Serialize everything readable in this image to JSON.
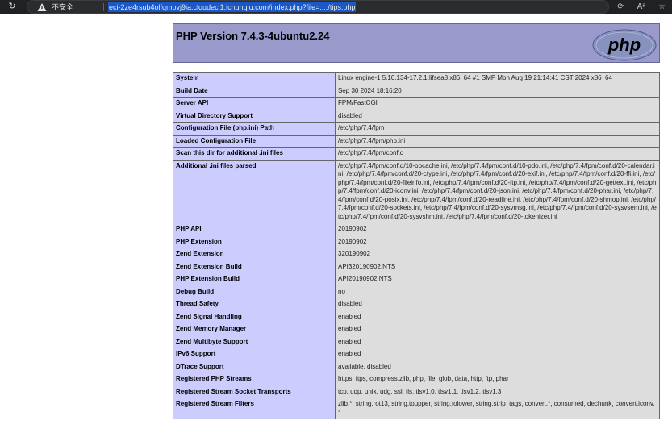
{
  "browser": {
    "reload_icon": "reload-icon",
    "security_label": "不安全",
    "url": "eci-2ze4rsub4olfqmovj9ia.cloudeci1.ichunqiu.com/index.php?file=..../tips.php",
    "right_icons": [
      "extension-icon",
      "read-aloud-icon",
      "favorite-icon"
    ]
  },
  "phpinfo": {
    "title": "PHP Version 7.4.3-4ubuntu2.24",
    "logo_text": "php",
    "colors": {
      "header_bg": "#9999cc",
      "key_bg": "#ccccff",
      "value_bg": "#dddddd",
      "logo_bg": "#8892bf"
    },
    "rows": [
      {
        "key": "System",
        "value": "Linux engine-1 5.10.134-17.2.1.lifsea8.x86_64 #1 SMP Mon Aug 19 21:14:41 CST 2024 x86_64"
      },
      {
        "key": "Build Date",
        "value": "Sep 30 2024 18:16:20"
      },
      {
        "key": "Server API",
        "value": "FPM/FastCGI"
      },
      {
        "key": "Virtual Directory Support",
        "value": "disabled"
      },
      {
        "key": "Configuration File (php.ini) Path",
        "value": "/etc/php/7.4/fpm"
      },
      {
        "key": "Loaded Configuration File",
        "value": "/etc/php/7.4/fpm/php.ini"
      },
      {
        "key": "Scan this dir for additional .ini files",
        "value": "/etc/php/7.4/fpm/conf.d"
      },
      {
        "key": "Additional .ini files parsed",
        "value": "/etc/php/7.4/fpm/conf.d/10-opcache.ini, /etc/php/7.4/fpm/conf.d/10-pdo.ini, /etc/php/7.4/fpm/conf.d/20-calendar.ini, /etc/php/7.4/fpm/conf.d/20-ctype.ini, /etc/php/7.4/fpm/conf.d/20-exif.ini, /etc/php/7.4/fpm/conf.d/20-ffi.ini, /etc/php/7.4/fpm/conf.d/20-fileinfo.ini, /etc/php/7.4/fpm/conf.d/20-ftp.ini, /etc/php/7.4/fpm/conf.d/20-gettext.ini, /etc/php/7.4/fpm/conf.d/20-iconv.ini, /etc/php/7.4/fpm/conf.d/20-json.ini, /etc/php/7.4/fpm/conf.d/20-phar.ini, /etc/php/7.4/fpm/conf.d/20-posix.ini, /etc/php/7.4/fpm/conf.d/20-readline.ini, /etc/php/7.4/fpm/conf.d/20-shmop.ini, /etc/php/7.4/fpm/conf.d/20-sockets.ini, /etc/php/7.4/fpm/conf.d/20-sysvmsg.ini, /etc/php/7.4/fpm/conf.d/20-sysvsem.ini, /etc/php/7.4/fpm/conf.d/20-sysvshm.ini, /etc/php/7.4/fpm/conf.d/20-tokenizer.ini"
      },
      {
        "key": "PHP API",
        "value": "20190902"
      },
      {
        "key": "PHP Extension",
        "value": "20190902"
      },
      {
        "key": "Zend Extension",
        "value": "320190902"
      },
      {
        "key": "Zend Extension Build",
        "value": "API320190902,NTS"
      },
      {
        "key": "PHP Extension Build",
        "value": "API20190902,NTS"
      },
      {
        "key": "Debug Build",
        "value": "no"
      },
      {
        "key": "Thread Safety",
        "value": "disabled"
      },
      {
        "key": "Zend Signal Handling",
        "value": "enabled"
      },
      {
        "key": "Zend Memory Manager",
        "value": "enabled"
      },
      {
        "key": "Zend Multibyte Support",
        "value": "enabled"
      },
      {
        "key": "IPv6 Support",
        "value": "enabled"
      },
      {
        "key": "DTrace Support",
        "value": "available, disabled"
      },
      {
        "key": "Registered PHP Streams",
        "value": "https, ftps, compress.zlib, php, file, glob, data, http, ftp, phar"
      },
      {
        "key": "Registered Stream Socket Transports",
        "value": "tcp, udp, unix, udg, ssl, tls, tlsv1.0, tlsv1.1, tlsv1.2, tlsv1.3"
      },
      {
        "key": "Registered Stream Filters",
        "value": "zlib.*, string.rot13, string.toupper, string.tolower, string.strip_tags, convert.*, consumed, dechunk, convert.iconv.*"
      }
    ]
  }
}
